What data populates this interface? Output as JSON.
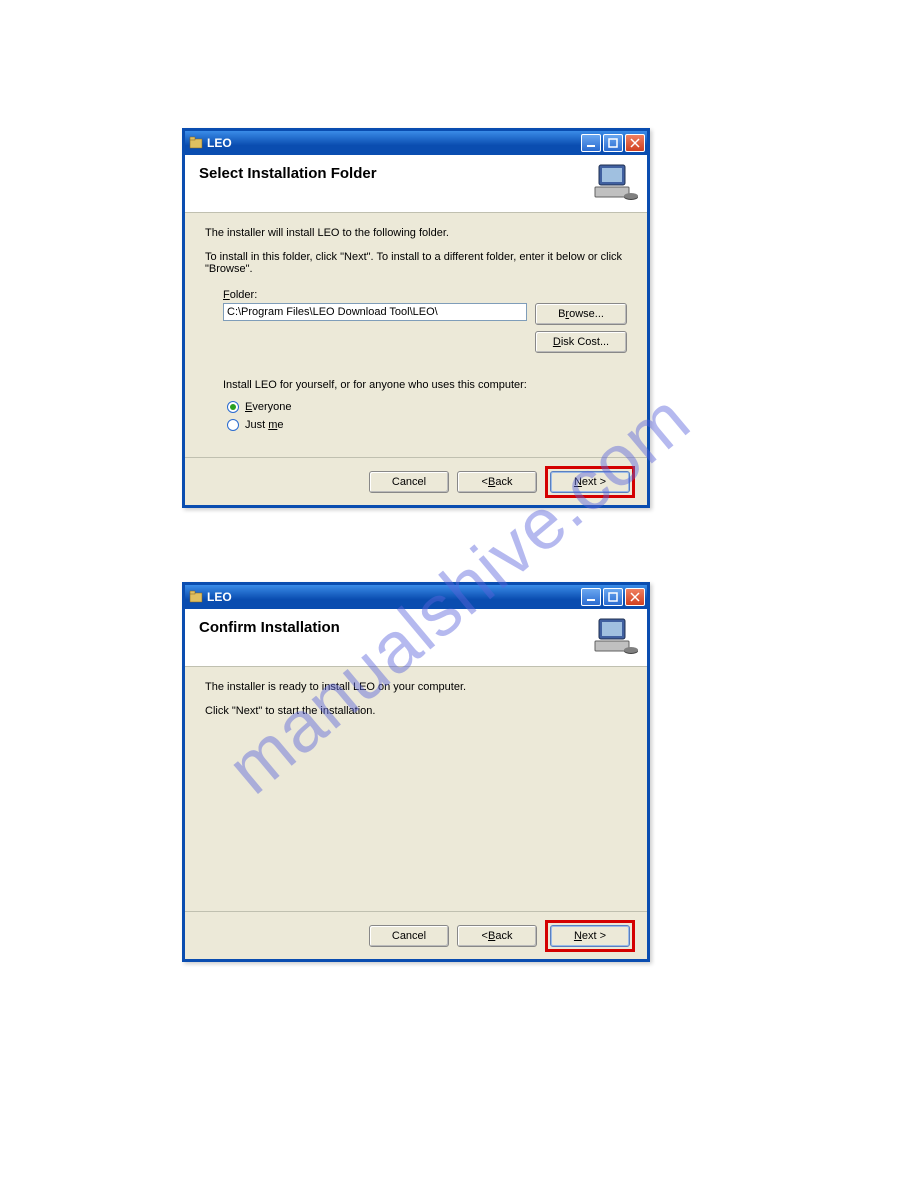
{
  "watermark": "manualshive.com",
  "dialog1": {
    "title": "LEO",
    "heading": "Select Installation Folder",
    "para1": "The installer will install LEO to the following folder.",
    "para2": "To install in this folder, click \"Next\". To install to a different folder, enter it below or click \"Browse\".",
    "folder_label": "Folder:",
    "folder_value": "C:\\Program Files\\LEO Download Tool\\LEO\\",
    "browse_label": "Browse...",
    "diskcost_label": "Disk Cost...",
    "install_for_text": "Install LEO for yourself, or for anyone who uses this computer:",
    "radio_everyone": "Everyone",
    "radio_justme": "Just me",
    "cancel": "Cancel",
    "back": "< Back",
    "next": "Next >"
  },
  "dialog2": {
    "title": "LEO",
    "heading": "Confirm Installation",
    "para1": "The installer is ready to install LEO on your computer.",
    "para2": "Click \"Next\" to start the installation.",
    "cancel": "Cancel",
    "back": "< Back",
    "next": "Next >"
  }
}
